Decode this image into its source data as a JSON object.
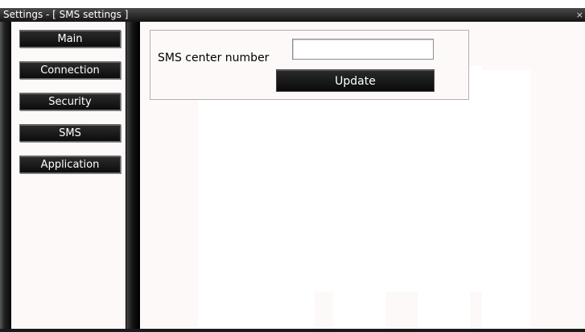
{
  "window": {
    "title": "Settings - [ SMS settings ]",
    "close_glyph": "×"
  },
  "sidebar": {
    "items": [
      {
        "label": "Main"
      },
      {
        "label": "Connection"
      },
      {
        "label": "Security"
      },
      {
        "label": "SMS"
      },
      {
        "label": "Application"
      }
    ]
  },
  "sms_panel": {
    "center_number_label": "SMS center number",
    "center_number_value": "",
    "update_label": "Update"
  },
  "colors": {
    "chrome_dark": "#141414",
    "panel_bg": "#fdf9f9",
    "button_text": "#ffffff"
  },
  "icons": {
    "close": "close-icon"
  }
}
